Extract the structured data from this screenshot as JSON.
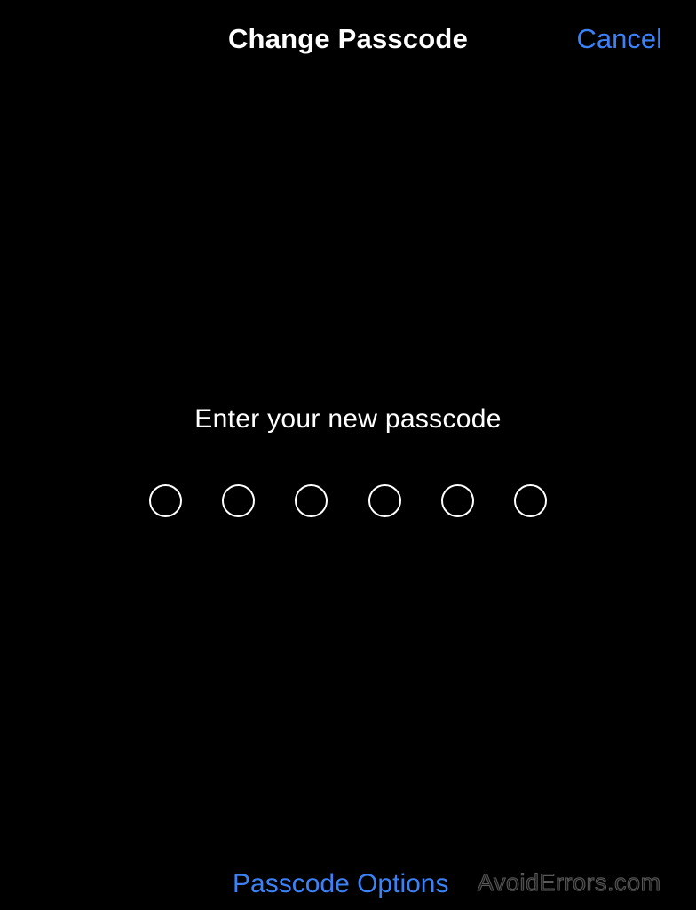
{
  "header": {
    "title": "Change Passcode",
    "cancel_label": "Cancel"
  },
  "passcode": {
    "prompt": "Enter your new passcode",
    "digits_total": 6,
    "digits_entered": 0
  },
  "footer": {
    "options_label": "Passcode Options"
  },
  "watermark": {
    "text": "AvoidErrors.com"
  },
  "colors": {
    "background": "#000000",
    "text": "#ffffff",
    "accent": "#3c82f6"
  }
}
